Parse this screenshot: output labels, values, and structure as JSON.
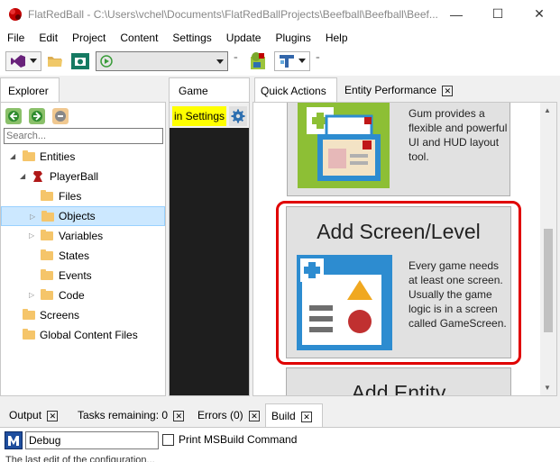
{
  "window": {
    "title": "FlatRedBall - C:\\Users\\vchel\\Documents\\FlatRedBallProjects\\Beefball\\Beefball\\Beef...",
    "minimize": "—",
    "maximize": "☐",
    "close": "✕"
  },
  "menu": [
    "File",
    "Edit",
    "Project",
    "Content",
    "Settings",
    "Update",
    "Plugins",
    "Help"
  ],
  "toolbar": {
    "grip1": "⁼",
    "grip2": "⁼"
  },
  "explorer": {
    "tab_label": "Explorer",
    "search_placeholder": "Search...",
    "tree": {
      "entities": "Entities",
      "player_ball": "PlayerBall",
      "files": "Files",
      "objects": "Objects",
      "variables": "Variables",
      "states": "States",
      "events": "Events",
      "code": "Code",
      "screens": "Screens",
      "global_content_files": "Global Content Files"
    }
  },
  "game": {
    "tab_label": "Game",
    "settings_button": "in Settings"
  },
  "quick_actions": {
    "tab_label": "Quick Actions",
    "entity_perf_tab": "Entity Performance",
    "gum_card_desc": "Gum provides a flexible and powerful UI and HUD layout tool.",
    "add_screen_title": "Add Screen/Level",
    "add_screen_desc": "Every game needs at least one screen. Usually the game logic is in a screen called GameScreen.",
    "add_entity_title": "Add Entity"
  },
  "bottom": {
    "tabs": {
      "output": "Output",
      "tasks": "Tasks remaining: 0",
      "errors": "Errors (0)",
      "build": "Build"
    },
    "config_value": "Debug",
    "print_msbuild_label": "Print MSBuild Command",
    "status_partial": "The last edit of the configuration..."
  },
  "colors": {
    "highlight": "#e00000",
    "yellow_button": "#ffff00",
    "selection": "#cce8ff",
    "folder": "#f5c56a",
    "card_bg": "#e1e1e1",
    "game_canvas": "#1e1e1e"
  }
}
